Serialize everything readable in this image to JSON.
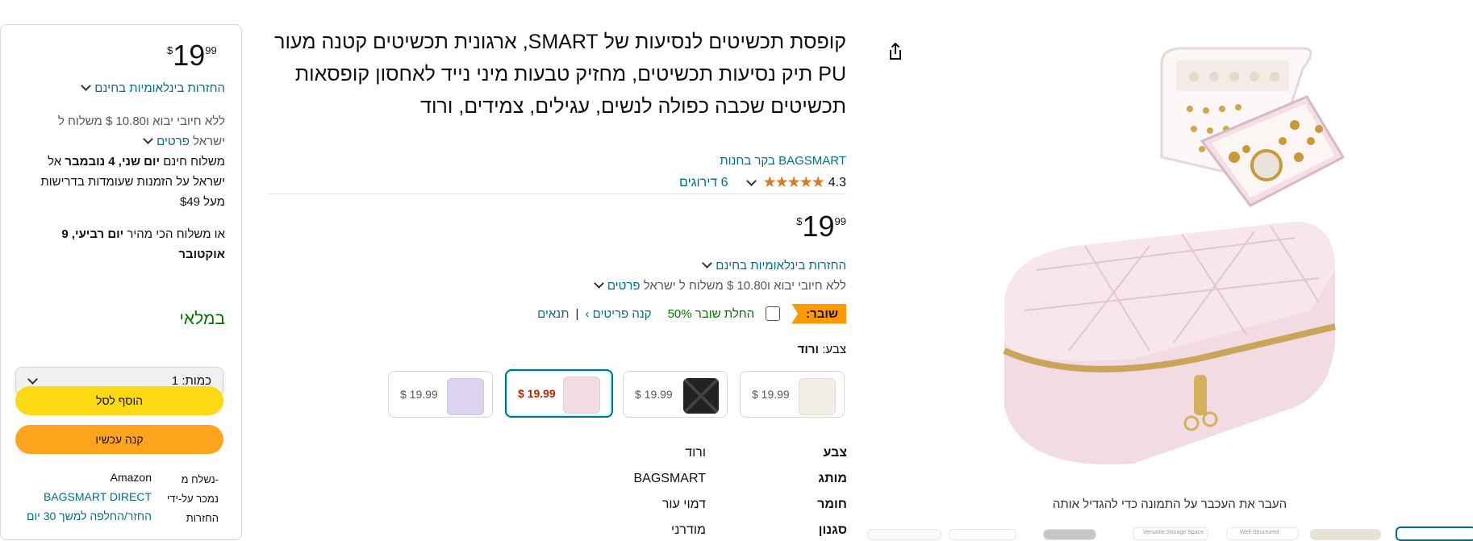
{
  "buybox": {
    "price": {
      "symbol": "$",
      "whole": "19",
      "fraction": "99"
    },
    "returns_link": "החזרות בינלאומיות בחינם",
    "import_line1": "ללא חיובי יבוא ו10.80 $ משלוח ל",
    "import_line2": "ישראל",
    "details_link": "פרטים",
    "delivery_prefix": "משלוח חינם ",
    "delivery_date": "יום שני, 4 נובמבר",
    "delivery_rest": " אל ישראל על הזמנות שעומדות בדרישות מעל $49",
    "fastest_prefix": "או משלוח הכי מהיר ",
    "fastest_date": "יום רביעי, 9 אוקטובר",
    "stock": "במלאי",
    "qty_label": "כמות:",
    "qty_value": "1",
    "add_to_cart": "הוסף לסל",
    "buy_now": "קנה עכשיו",
    "ships_from_label": "נשלח מ-",
    "ships_from_value": "Amazon",
    "sold_by_label": "נמכר על-ידי",
    "sold_by_value": "BAGSMART DIRECT",
    "returns_label": "החזרות",
    "returns_value": "החזר/החלפה למשך 30 יום"
  },
  "product": {
    "title": "קופסת תכשיטים לנסיעות של SMART, ארגונית תכשיטים קטנה מעור PU תיק נסיעות תכשיטים, מחזיק טבעות מיני נייד לאחסון קופסאות תכשיטים שכבה כפולה לנשים, עגילים, צמידים, ורוד",
    "store_link": "בקר בחנות BAGSMART",
    "rating": "4.3",
    "ratings_count": "6 דירוגים",
    "price": {
      "symbol": "$",
      "whole": "19",
      "fraction": "99"
    },
    "returns_link": "החזרות בינלאומיות בחינם",
    "import_line": "ללא חיובי יבוא ו10.80 $ משלוח ל ישראל",
    "details_link": "פרטים",
    "coupon_badge": "שובר:",
    "coupon_text": "החלת שובר 50%",
    "coupon_shop": "קנה פריטים ›",
    "coupon_sep": "|",
    "coupon_terms": "תנאים",
    "color_label": "צבע:",
    "color_value": "ורוד",
    "swatches": [
      {
        "price": "$ 19.99",
        "color": "#f3efe6"
      },
      {
        "price": "$ 19.99",
        "color": "#222222"
      },
      {
        "price": "$ 19.99",
        "color": "#f2dde3"
      },
      {
        "price": "$ 19.99",
        "color": "#ddd3f0"
      }
    ],
    "specs": [
      {
        "key": "צבע",
        "value": "ורוד"
      },
      {
        "key": "מותג",
        "value": "BAGSMART"
      },
      {
        "key": "חומר",
        "value": "דמוי עור"
      },
      {
        "key": "סגנון",
        "value": "מודרני"
      }
    ]
  },
  "gallery": {
    "hover_hint": "העבר את העכבר על התמונה כדי להגדיל אותה",
    "thumb_text_1": "Versatile Storage Space",
    "thumb_text_2": "Well-Structured"
  },
  "colors": {
    "link": "#007185",
    "cart": "#ffd814",
    "buy": "#ffa41c",
    "stock": "#007600",
    "star": "#de7921",
    "coupon_badge": "#ff9900"
  }
}
